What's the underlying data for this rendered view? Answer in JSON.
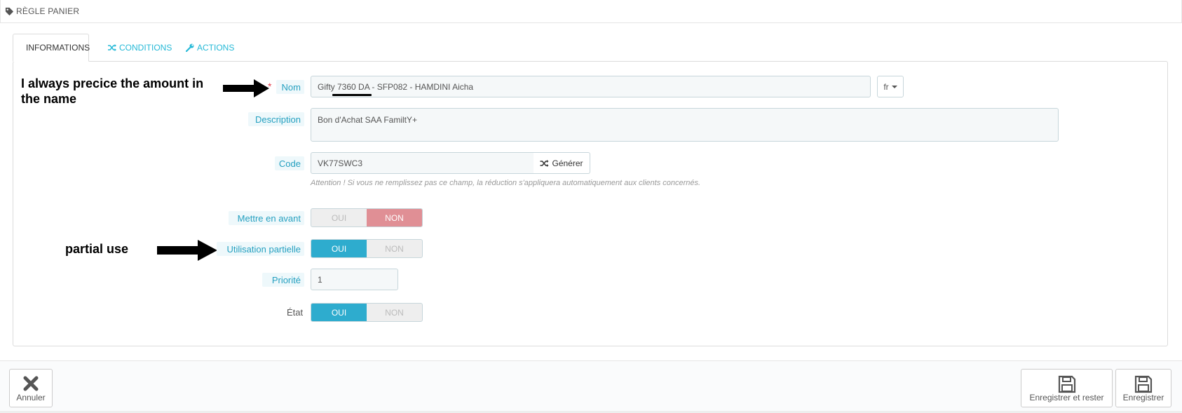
{
  "header": {
    "title": "RÈGLE PANIER",
    "icon": "tag-icon"
  },
  "tabs": [
    {
      "label": "INFORMATIONS",
      "icon": "info-icon",
      "active": true
    },
    {
      "label": "CONDITIONS",
      "icon": "shuffle-icon",
      "active": false
    },
    {
      "label": "ACTIONS",
      "icon": "wrench-icon",
      "active": false
    }
  ],
  "form": {
    "name": {
      "label": "Nom",
      "required": "*",
      "value": "Gifty 7360 DA - SFP082 - HAMDINI Aicha",
      "lang": "fr"
    },
    "description": {
      "label": "Description",
      "value": "Bon d'Achat SAA FamiltY+"
    },
    "code": {
      "label": "Code",
      "value": "VK77SWC3",
      "generate_label": "Générer",
      "help": "Attention ! Si vous ne remplissez pas ce champ, la réduction s'appliquera automatiquement aux clients concernés."
    },
    "highlight": {
      "label": "Mettre en avant",
      "yes": "OUI",
      "no": "NON",
      "selected": "NON"
    },
    "partial_use": {
      "label": "Utilisation partielle",
      "yes": "OUI",
      "no": "NON",
      "selected": "OUI"
    },
    "priority": {
      "label": "Priorité",
      "value": "1"
    },
    "status": {
      "label": "État",
      "yes": "OUI",
      "no": "NON",
      "selected": "OUI"
    }
  },
  "annotations": {
    "name_note": "I always precice the amount in the name",
    "partial_note": "partial use"
  },
  "footer": {
    "cancel": "Annuler",
    "save_stay": "Enregistrer et rester",
    "save": "Enregistrer"
  },
  "colors": {
    "accent": "#25b9d7",
    "switch_on": "#2eacce",
    "switch_no": "#e08f95",
    "required": "#e3434f"
  }
}
